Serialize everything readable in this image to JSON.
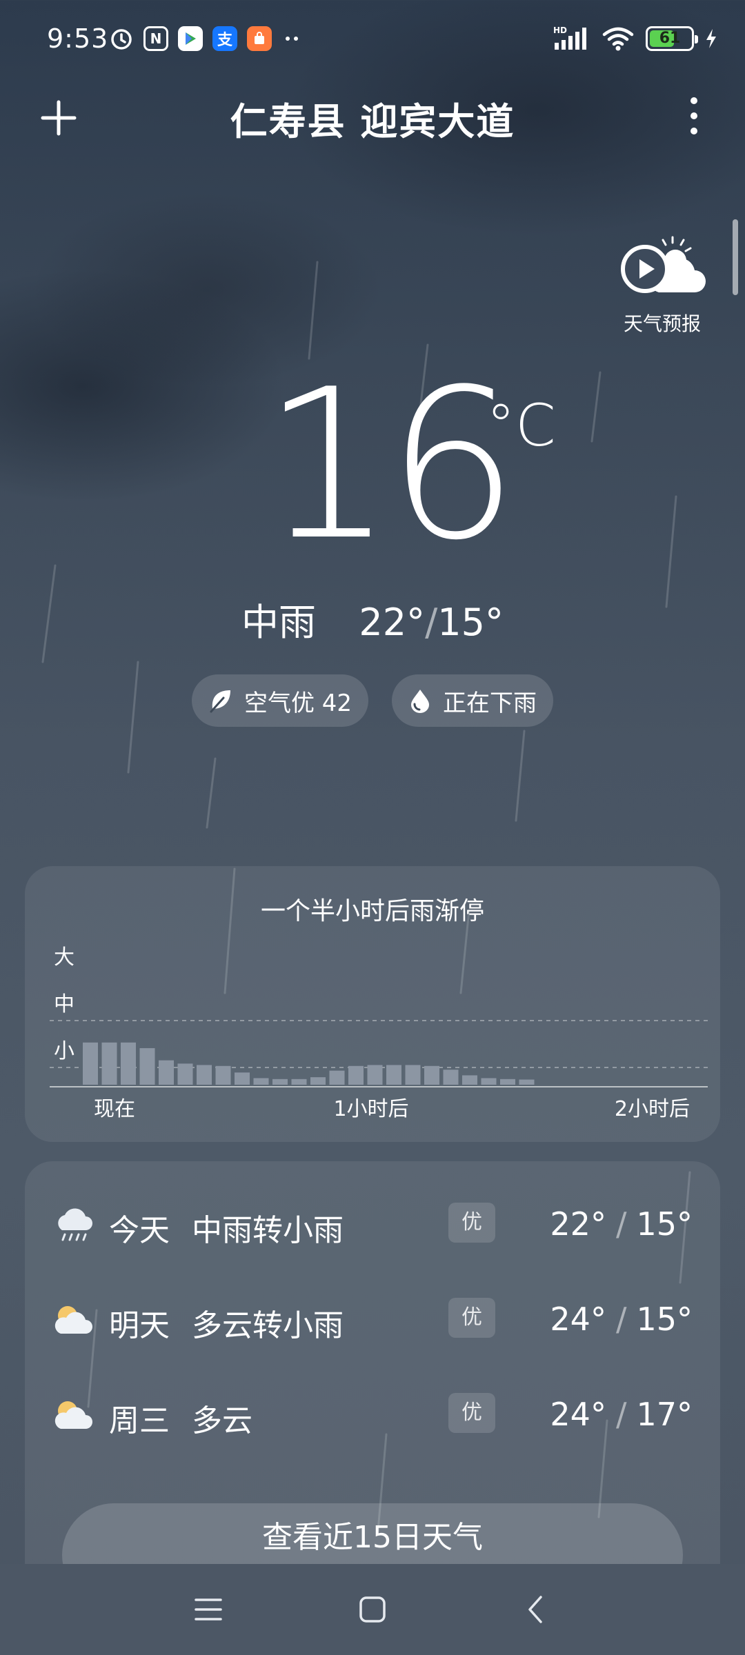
{
  "status_bar": {
    "time": "9:53",
    "battery_percent": "61",
    "battery_level": 0.61,
    "network_label": "HD"
  },
  "header": {
    "location": "仁寿县 迎宾大道",
    "add_icon": "plus-icon",
    "more_icon": "more-vertical-icon"
  },
  "forecast_video": {
    "label": "天气预报",
    "icon": "play-cloud-icon"
  },
  "current": {
    "temperature": "16",
    "unit": "°C",
    "condition": "中雨",
    "high": "22°",
    "slash": "/",
    "low": "15°"
  },
  "chips": {
    "air_quality": "空气优 42",
    "rain_status": "正在下雨"
  },
  "rain_card": {
    "title": "一个半小时后雨渐停"
  },
  "chart_data": {
    "type": "bar",
    "title": "一个半小时后雨渐停",
    "y_levels": [
      "大",
      "中",
      "小"
    ],
    "x_ticks": [
      "现在",
      "1小时后",
      "2小时后"
    ],
    "xlim_minutes": [
      0,
      120
    ],
    "ylim": [
      0,
      3
    ],
    "grid": "dashed at 中 and 大",
    "values": [
      0.9,
      0.9,
      0.9,
      0.78,
      0.52,
      0.45,
      0.42,
      0.4,
      0.26,
      0.14,
      0.12,
      0.12,
      0.16,
      0.3,
      0.4,
      0.42,
      0.42,
      0.42,
      0.4,
      0.32,
      0.2,
      0.14,
      0.12,
      0.11
    ]
  },
  "daily": [
    {
      "day": "今天",
      "desc": "中雨转小雨",
      "aqi": "优",
      "high": "22°",
      "sep": "/",
      "low": "15°",
      "icon": "rain-cloud-icon"
    },
    {
      "day": "明天",
      "desc": "多云转小雨",
      "aqi": "优",
      "high": "24°",
      "sep": "/",
      "low": "15°",
      "icon": "partly-cloudy-icon"
    },
    {
      "day": "周三",
      "desc": "多云",
      "aqi": "优",
      "high": "24°",
      "sep": "/",
      "low": "17°",
      "icon": "partly-cloudy-icon"
    }
  ],
  "more_days_label": "查看近15日天气",
  "nav": {
    "menu_icon": "menu-icon",
    "home_icon": "home-icon",
    "back_icon": "back-icon"
  },
  "colors": {
    "background": "#3b4858",
    "battery_fill": "#5bd151",
    "card": "rgba(255,255,255,0.08)",
    "bar": "#8c96a3"
  }
}
